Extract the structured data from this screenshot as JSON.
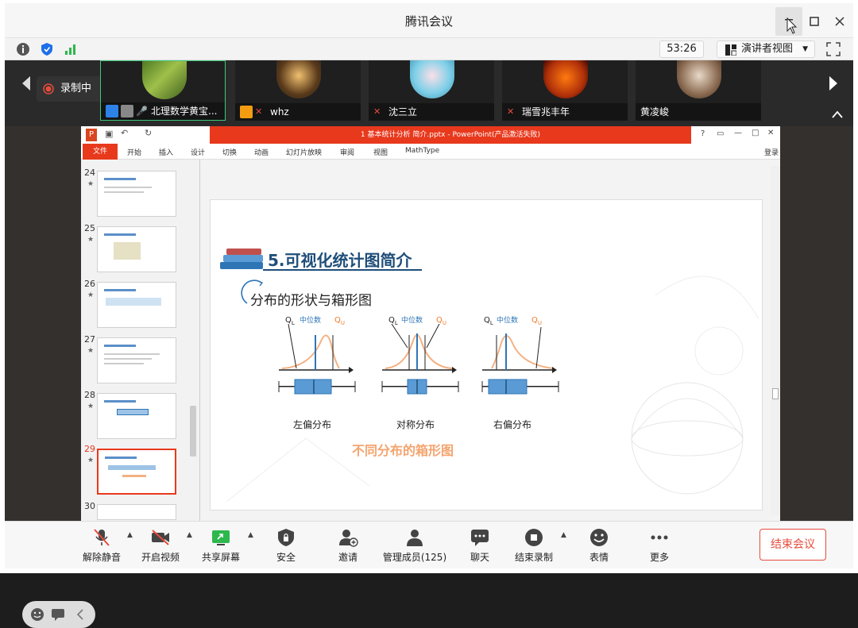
{
  "window": {
    "title": "腾讯会议"
  },
  "status": {
    "timer": "53:26",
    "view_label": "演讲者视图"
  },
  "recording": {
    "label": "录制中"
  },
  "participants": [
    {
      "name": "北理数学黄宝..."
    },
    {
      "name": "whz"
    },
    {
      "name": "沈三立"
    },
    {
      "name": "瑞雪兆丰年"
    },
    {
      "name": "黄凌峻"
    }
  ],
  "ppt": {
    "window_title": "1 基本统计分析 简介.pptx - PowerPoint(产品激活失败)",
    "ribbon_tabs": [
      "文件",
      "开始",
      "插入",
      "设计",
      "切换",
      "动画",
      "幻灯片放映",
      "审阅",
      "视图",
      "MathType"
    ],
    "login": "登录",
    "thumbnails": [
      {
        "num": "24"
      },
      {
        "num": "25"
      },
      {
        "num": "26"
      },
      {
        "num": "27"
      },
      {
        "num": "28"
      },
      {
        "num": "29"
      },
      {
        "num": "30"
      }
    ],
    "star": "★"
  },
  "slide": {
    "heading": "5.可视化统计图简介",
    "subheading": "分布的形状与箱形图",
    "median_label": "中位数",
    "q1_label": "Q",
    "q3_label": "Q",
    "q1_sub": "L",
    "q3_sub": "U",
    "plots": [
      {
        "caption": "左偏分布"
      },
      {
        "caption": "对称分布"
      },
      {
        "caption": "右偏分布"
      }
    ],
    "footer": "不同分布的箱形图"
  },
  "toolbar": {
    "items": [
      {
        "label": "解除静音"
      },
      {
        "label": "开启视频"
      },
      {
        "label": "共享屏幕"
      },
      {
        "label": "安全"
      },
      {
        "label": "邀请"
      },
      {
        "label": "管理成员(125)"
      },
      {
        "label": "聊天"
      },
      {
        "label": "结束录制"
      },
      {
        "label": "表情"
      },
      {
        "label": "更多"
      }
    ],
    "end_meeting": "结束会议"
  },
  "colors": {
    "accent_red": "#e8391d",
    "slide_blue": "#2e75b6",
    "slide_orange": "#ed7d31"
  }
}
